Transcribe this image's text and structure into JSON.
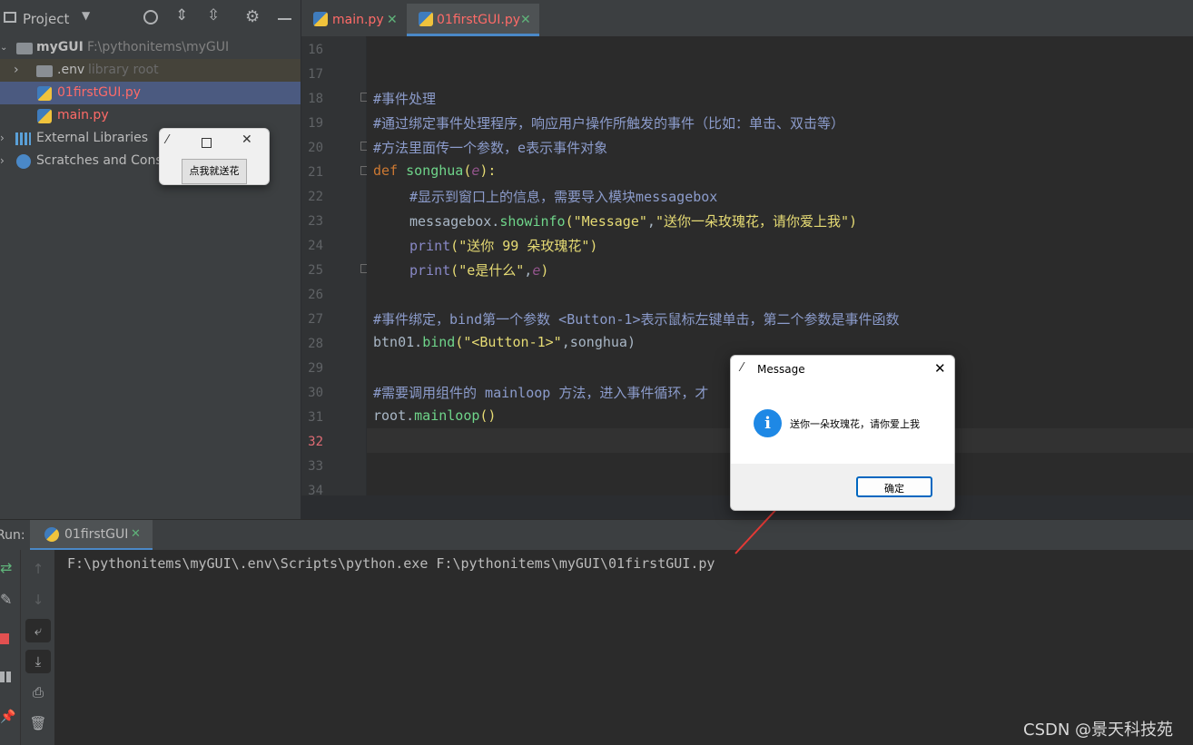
{
  "project_panel": {
    "title": "Project",
    "tree": [
      {
        "label": "myGUI",
        "path": "F:\\pythonitems\\myGUI"
      },
      {
        "label": ".env",
        "note": "library root"
      },
      {
        "label": "01firstGUI.py"
      },
      {
        "label": "main.py"
      },
      {
        "label": "External Libraries"
      },
      {
        "label": "Scratches and Conso"
      }
    ]
  },
  "tabs": [
    {
      "label": "main.py"
    },
    {
      "label": "01firstGUI.py"
    }
  ],
  "editor": {
    "line_numbers": [
      "16",
      "17",
      "18",
      "19",
      "20",
      "21",
      "22",
      "23",
      "24",
      "25",
      "26",
      "27",
      "28",
      "29",
      "30",
      "31",
      "32",
      "33",
      "34"
    ],
    "current_line": "32",
    "lines": {
      "l18": "#事件处理",
      "l19": "#通过绑定事件处理程序，响应用户操作所触发的事件（比如：单击、双击等）",
      "l20": "#方法里面传一个参数，e表示事件对象",
      "l21_kw": "def ",
      "l21_fn": "songhua",
      "l21_p1": "(",
      "l21_param": "e",
      "l21_p2": "):",
      "l22": "#显示到窗口上的信息，需要导入模块messagebox",
      "l23_a": "messagebox.",
      "l23_fn": "showinfo",
      "l23_b": "(",
      "l23_s1": "\"Message\"",
      "l23_c": ",",
      "l23_s2": "\"送你一朵玫瑰花，请你爱上我\"",
      "l23_d": ")",
      "l24_bi": "print",
      "l24_a": "(",
      "l24_s": "\"送你 99 朵玫瑰花\"",
      "l24_b": ")",
      "l25_bi": "print",
      "l25_a": "(",
      "l25_s": "\"e是什么\"",
      "l25_c": ",",
      "l25_param": "e",
      "l25_b": ")",
      "l27": "#事件绑定，bind第一个参数 <Button-1>表示鼠标左键单击，第二个参数是事件函数",
      "l28_a": "btn01.",
      "l28_fn": "bind",
      "l28_b": "(",
      "l28_s": "\"<Button-1>\"",
      "l28_c": ",songhua)",
      "l30": "#需要调用组件的 mainloop 方法，进入事件循环，才",
      "l31_a": "root.",
      "l31_fn": "mainloop",
      "l31_b": "()"
    }
  },
  "tk_window": {
    "button_label": "点我就送花"
  },
  "message_box": {
    "title": "Message",
    "text": "送你一朵玫瑰花，请你爱上我",
    "ok_label": "确定"
  },
  "run_panel": {
    "label": "Run:",
    "tab": "01firstGUI",
    "output": "F:\\pythonitems\\myGUI\\.env\\Scripts\\python.exe F:\\pythonitems\\myGUI\\01firstGUI.py"
  },
  "watermark": "CSDN @景天科技苑",
  "colors": {
    "arrow": "#e53935",
    "accent": "#0067c0",
    "info_icon": "#1e88e5"
  }
}
